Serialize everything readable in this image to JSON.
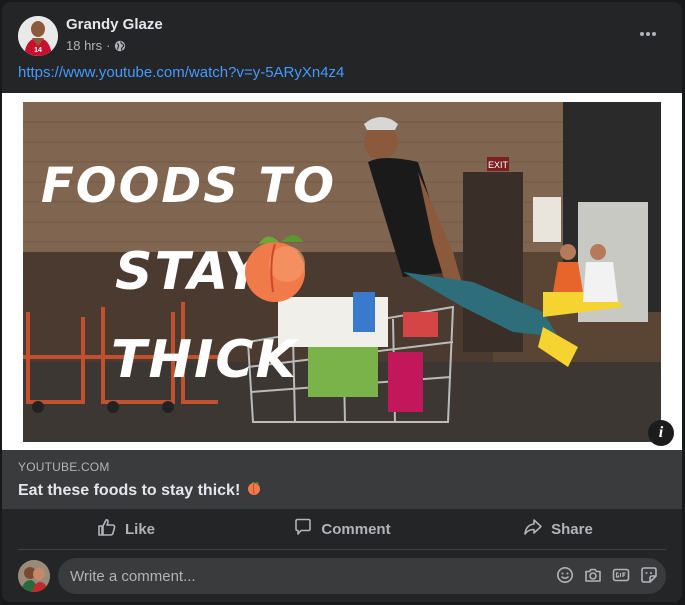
{
  "post": {
    "author": "Grandy Glaze",
    "time": "18 hrs",
    "separator": "·",
    "link_url": "https://www.youtube.com/watch?v=y-5ARyXn4z4"
  },
  "thumbnail": {
    "line1": "FOODS TO",
    "line2": "STAY",
    "line3": "THICK",
    "exit_sign": "EXIT",
    "jersey_number": "14"
  },
  "link_preview": {
    "domain": "YOUTUBE.COM",
    "title": "Eat these foods to stay thick!"
  },
  "actions": {
    "like": "Like",
    "comment": "Comment",
    "share": "Share"
  },
  "comment_box": {
    "placeholder": "Write a comment..."
  },
  "colors": {
    "card_bg": "#242526",
    "link": "#4599ff",
    "muted": "#b0b3b8",
    "text": "#e4e6eb",
    "peach": "#f07a4a"
  },
  "icons": [
    "globe-icon",
    "more-icon",
    "info-icon",
    "peach-emoji-icon",
    "like-icon",
    "comment-icon",
    "share-icon",
    "emoji-icon",
    "camera-icon",
    "gif-icon",
    "sticker-icon"
  ]
}
